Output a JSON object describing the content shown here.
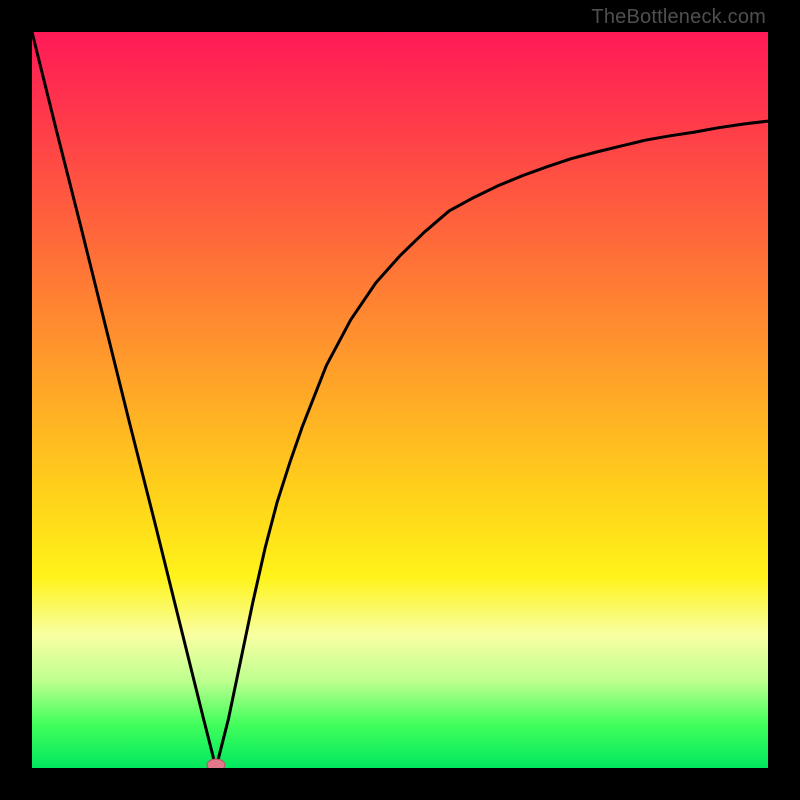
{
  "attribution": "TheBottleneck.com",
  "colors": {
    "frame": "#000000",
    "curve": "#000000",
    "marker_fill": "#e07a8a",
    "marker_stroke": "#b74c60"
  },
  "chart_data": {
    "type": "line",
    "title": "",
    "xlabel": "",
    "ylabel": "",
    "xlim": [
      0,
      1
    ],
    "ylim": [
      0,
      1
    ],
    "grid": false,
    "legend": false,
    "series": [
      {
        "name": "curve",
        "x": [
          0.0,
          0.033,
          0.067,
          0.1,
          0.133,
          0.167,
          0.2,
          0.233,
          0.25,
          0.267,
          0.3,
          0.317,
          0.333,
          0.35,
          0.367,
          0.4,
          0.433,
          0.467,
          0.5,
          0.533,
          0.567,
          0.6,
          0.633,
          0.667,
          0.7,
          0.733,
          0.767,
          0.8,
          0.833,
          0.867,
          0.9,
          0.933,
          0.967,
          1.0
        ],
        "y": [
          1.0,
          0.867,
          0.733,
          0.6,
          0.467,
          0.333,
          0.2,
          0.067,
          0.0,
          0.067,
          0.225,
          0.3,
          0.361,
          0.414,
          0.463,
          0.547,
          0.609,
          0.659,
          0.696,
          0.728,
          0.757,
          0.775,
          0.791,
          0.805,
          0.817,
          0.828,
          0.837,
          0.845,
          0.853,
          0.859,
          0.864,
          0.87,
          0.875,
          0.879
        ]
      }
    ],
    "annotations": [
      {
        "type": "marker",
        "x": 0.25,
        "y": 0.0,
        "label": ""
      }
    ]
  }
}
